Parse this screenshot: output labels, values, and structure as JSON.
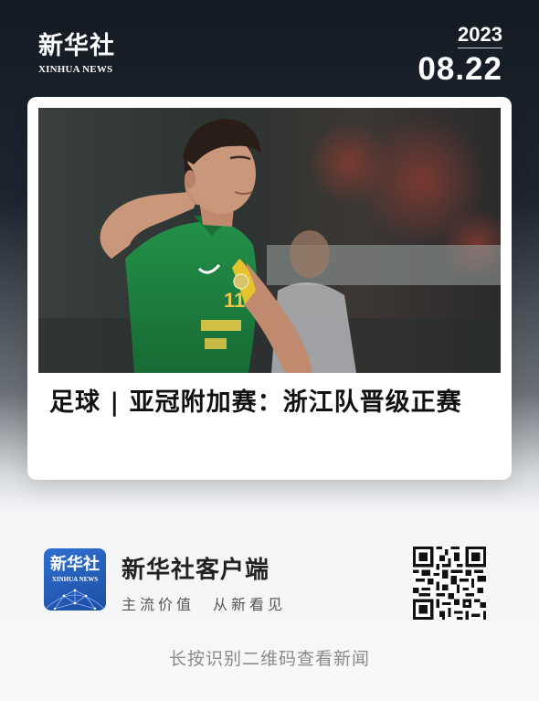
{
  "brand": {
    "name_cn": "新华社",
    "name_en": "XINHUA NEWS"
  },
  "date": {
    "year": "2023",
    "month_day": "08.22"
  },
  "article": {
    "headline": "足球 | 亚冠附加赛：浙江队晋级正赛",
    "photo": {
      "jersey_number": "11"
    }
  },
  "footer": {
    "app_logo": {
      "name_cn": "新华社",
      "name_en": "XINHUA NEWS"
    },
    "app_name": "新华社客户端",
    "slogan": "主流价值　从新看见",
    "hint": "长按识别二维码查看新闻"
  },
  "colors": {
    "header_bg": "#141b24",
    "jersey_green": "#1f8a3e",
    "logo_blue": "#2a63c4"
  },
  "icons": {
    "qr": "qr-code-icon"
  }
}
